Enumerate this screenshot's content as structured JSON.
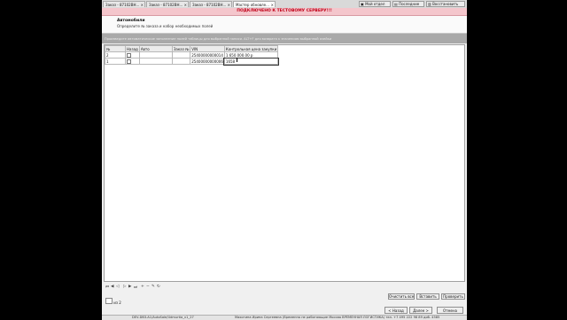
{
  "tabs": [
    {
      "label": "Заказ - 87102ВН..."
    },
    {
      "label": "Заказ - 87102ВН..."
    },
    {
      "label": "Заказ - 87102ВН..."
    },
    {
      "label": "Мастер обновле..."
    }
  ],
  "toolbar": {
    "my_section": "Мой отдел",
    "recent": "Последние",
    "restore": "Восстановить"
  },
  "banner": "ПОДКЛЮЧЕНО К ТЕСТОВОМУ СЕРВЕРУ!!!",
  "header": {
    "title": "Автомобили",
    "subtitle": "Определите № заказа и набор необходимых полей"
  },
  "hint": "Произведите автоматическое заполнение полей таблицы для выбранной записи. ALT+F для возврата к значениям выбранной ячейки",
  "grid": {
    "columns": [
      "№",
      "Назад",
      "Авто",
      "Заказ №",
      "VIN",
      "Контрольная цена закупки"
    ],
    "rows": [
      {
        "num": "2",
        "vin": "25400000000014",
        "price": "1 650 000.00 р"
      },
      {
        "num": "1",
        "vin": "25400000000006",
        "price": "1658"
      }
    ]
  },
  "pager": {
    "count_label": "из",
    "count": "2",
    "current": "2"
  },
  "buttons": {
    "clear_all": "Очистить все",
    "insert": "Вставить",
    "check": "Проверить",
    "back": "< Назад",
    "next": "Далее >",
    "cancel": "Отмена"
  },
  "status": {
    "left": "DEV-DB3.A1/AutoSale/Udmurtia_v1_27",
    "right": "Махотина Ирина Сергеевна (Временно не работающие Москва ВРЕМЕННАЯ ЛОГИСТИКА) тел. +7 495 222 98 89 доб. 4585"
  }
}
